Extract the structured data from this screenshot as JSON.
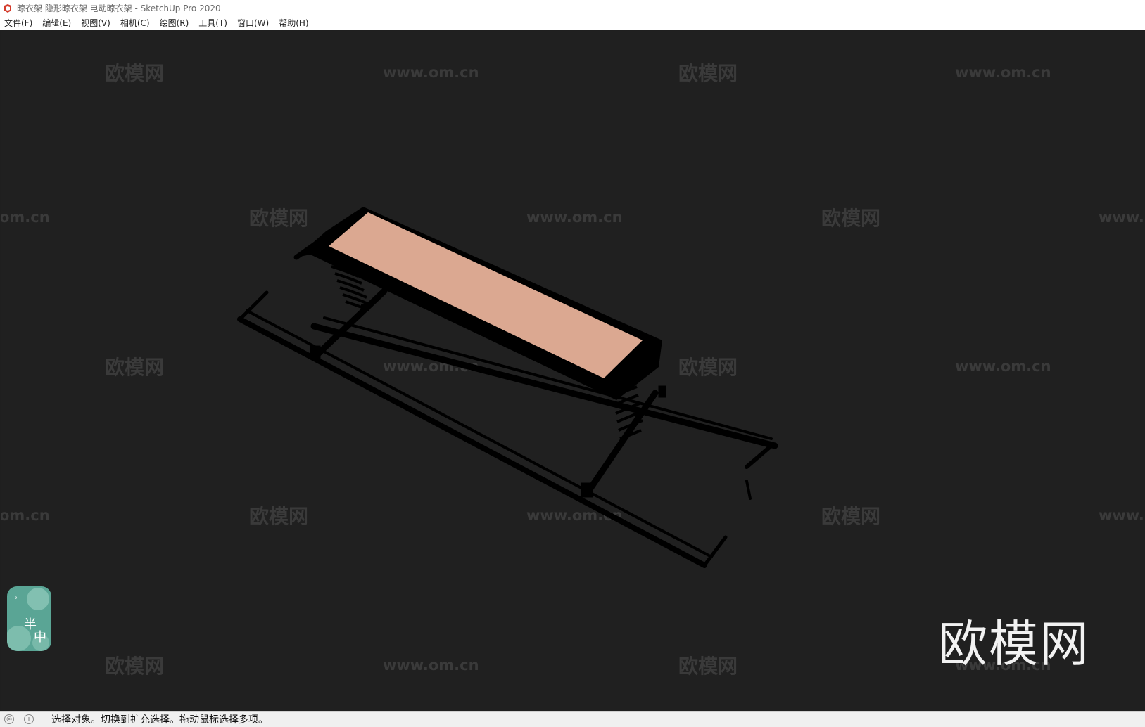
{
  "window": {
    "title": "晾衣架 隐形晾衣架 电动晾衣架 - SketchUp Pro 2020"
  },
  "menu": [
    {
      "label": "文件(F)"
    },
    {
      "label": "编辑(E)"
    },
    {
      "label": "视图(V)"
    },
    {
      "label": "相机(C)"
    },
    {
      "label": "绘图(R)"
    },
    {
      "label": "工具(T)"
    },
    {
      "label": "窗口(W)"
    },
    {
      "label": "帮助(H)"
    }
  ],
  "watermark": {
    "brand": "欧模网",
    "url": "www.om.cn",
    "partial_url": "om.cn",
    "partial_url_right": "www."
  },
  "logo": {
    "text": "欧模网"
  },
  "badge": {
    "char1": "半",
    "char2": "中"
  },
  "status": {
    "message": "选择对象。切换到扩充选择。拖动鼠标选择多项。"
  },
  "colors": {
    "viewport_bg": "#202020",
    "model_panel": "#dba891",
    "model_frame": "#000000",
    "badge_bg": "#5aa595"
  },
  "icons": {
    "app": "sketchup-icon",
    "status_geo": "geolocation-icon",
    "status_info": "info-icon"
  }
}
